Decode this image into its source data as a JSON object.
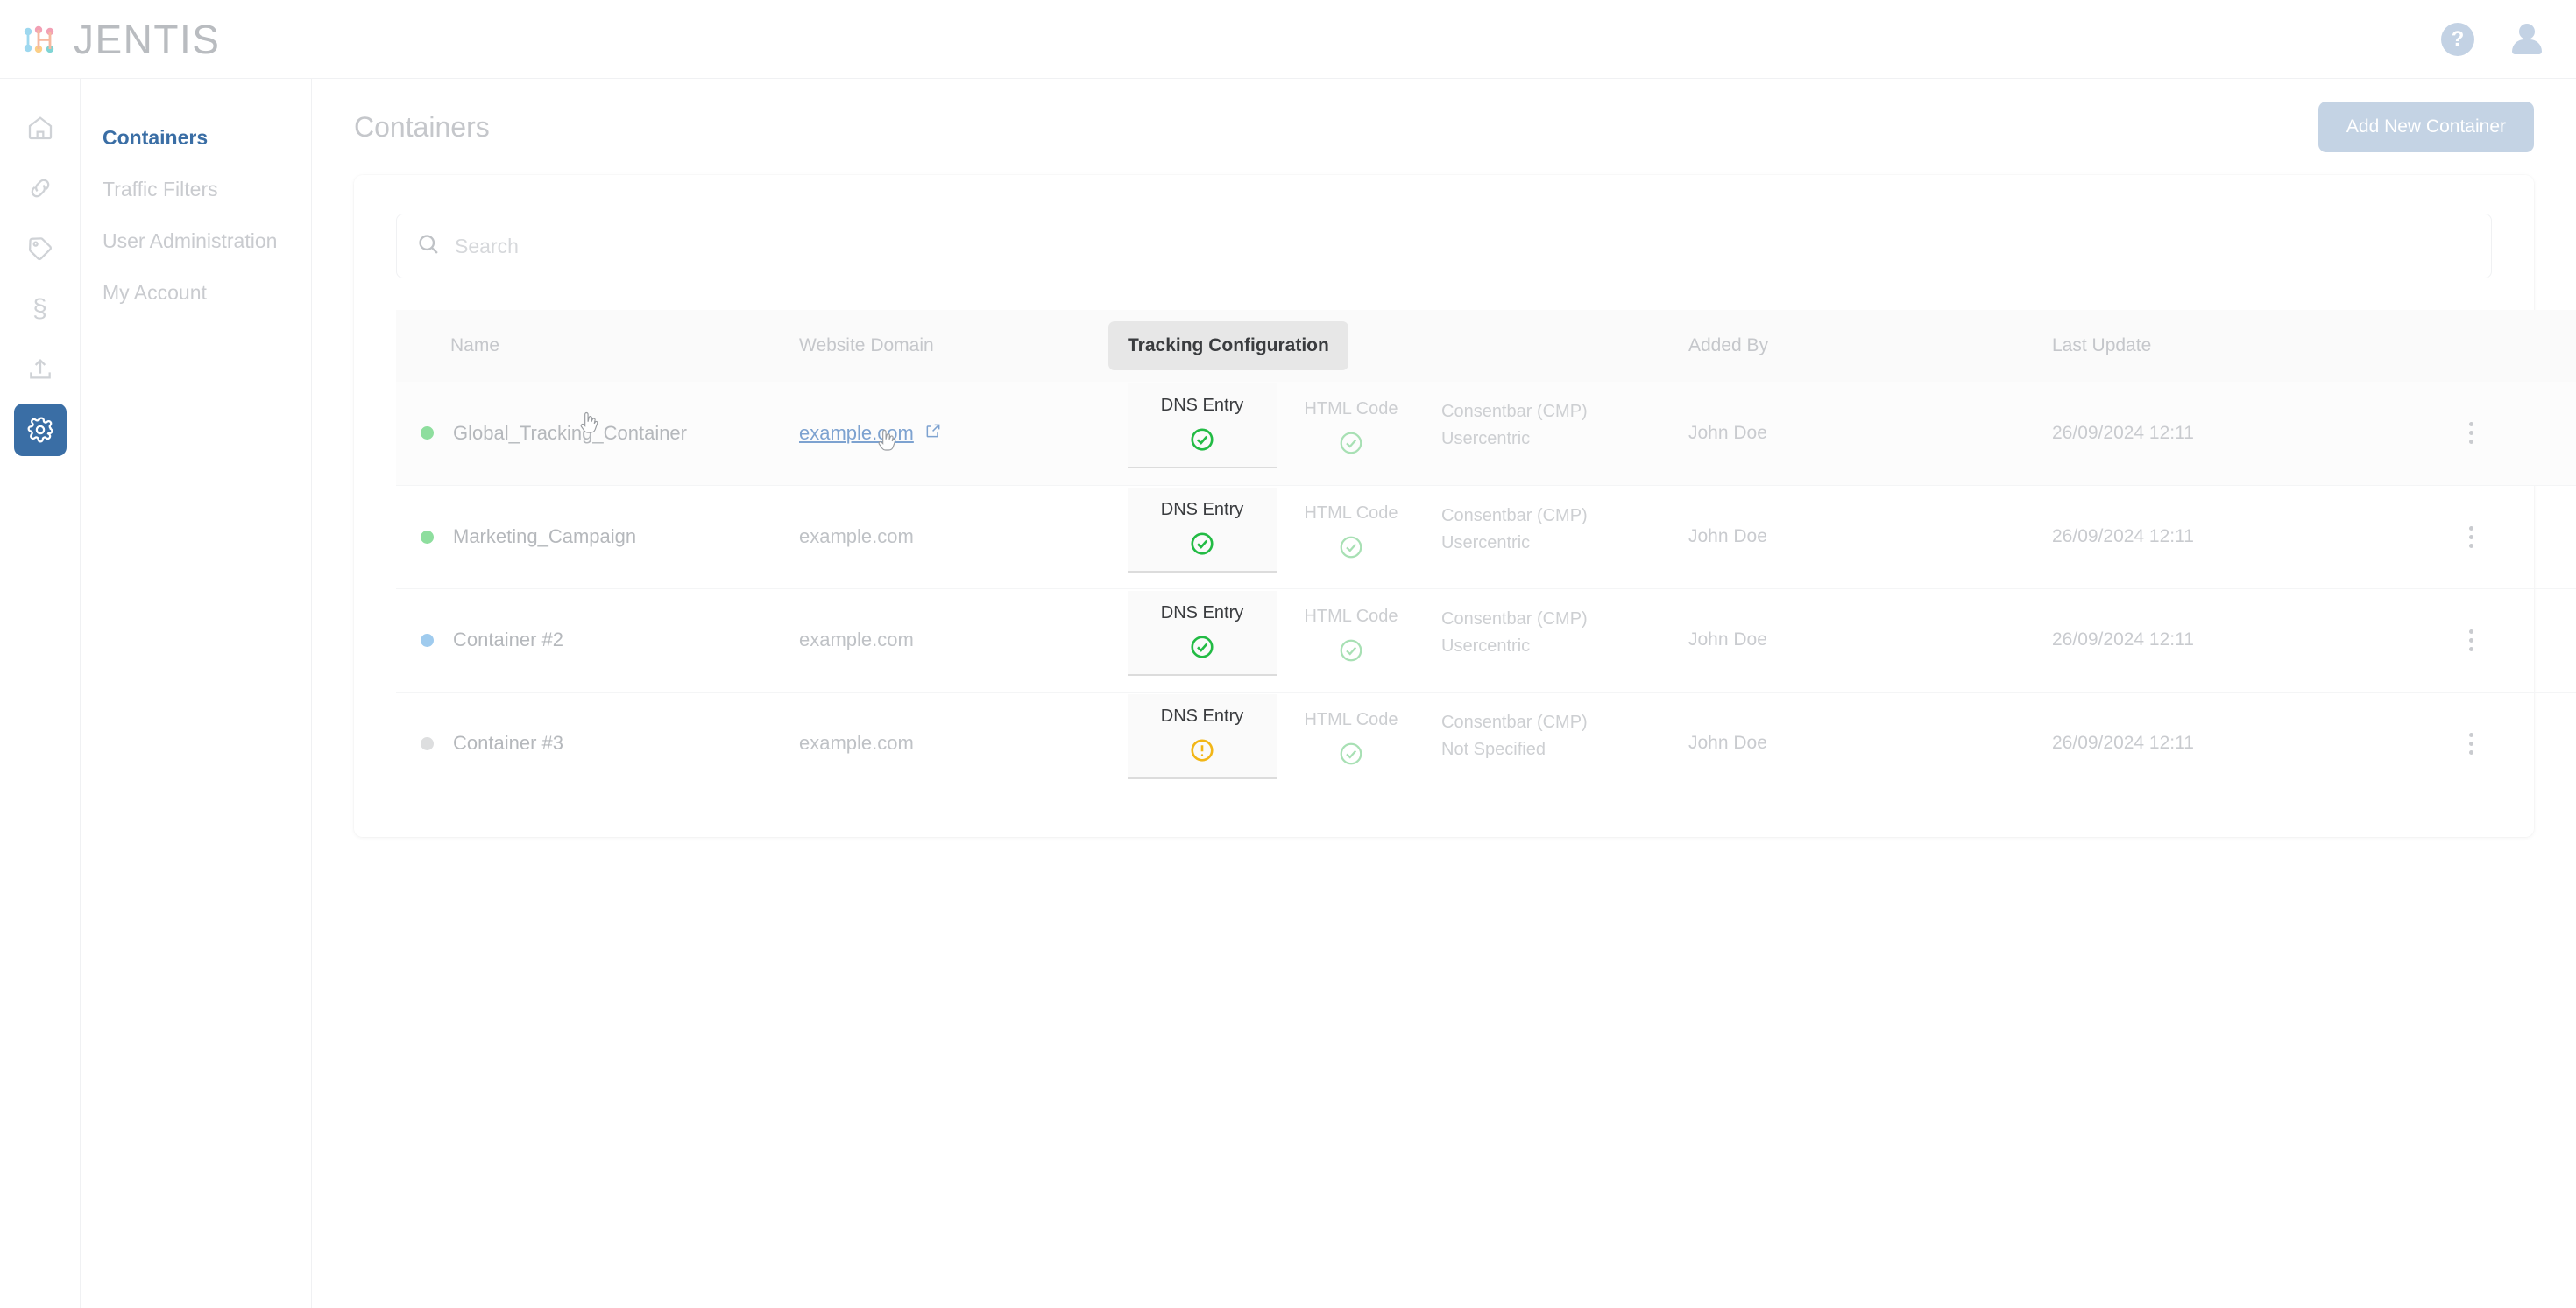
{
  "brand": {
    "name": "JENTIS"
  },
  "topbar": {
    "help_icon": "help-circle-icon",
    "help_glyph": "?",
    "account_icon": "user-avatar-icon"
  },
  "rail": {
    "items": [
      {
        "name": "home-icon",
        "label": "Home",
        "active": false
      },
      {
        "name": "link-icon",
        "label": "Connections",
        "active": false
      },
      {
        "name": "tag-icon",
        "label": "Tags",
        "active": false
      },
      {
        "name": "paragraph-icon",
        "label": "Legal",
        "glyph": "§",
        "active": false
      },
      {
        "name": "upload-icon",
        "label": "Publish",
        "active": false
      },
      {
        "name": "gear-icon",
        "label": "Settings",
        "active": true
      }
    ]
  },
  "sidebar": {
    "items": [
      {
        "label": "Containers",
        "active": true
      },
      {
        "label": "Traffic Filters",
        "active": false
      },
      {
        "label": "User Administration",
        "active": false
      },
      {
        "label": "My Account",
        "active": false
      }
    ]
  },
  "header": {
    "title": "Containers",
    "add_button_label": "Add New Container"
  },
  "search": {
    "placeholder": "Search",
    "value": "",
    "icon": "search-icon"
  },
  "table": {
    "columns": [
      {
        "key": "name",
        "label": "Name",
        "highlighted": false
      },
      {
        "key": "domain",
        "label": "Website Domain",
        "highlighted": false
      },
      {
        "key": "tracking",
        "label": "Tracking Configuration",
        "highlighted": true
      },
      {
        "key": "added",
        "label": "Added By",
        "highlighted": false
      },
      {
        "key": "updated",
        "label": "Last Update",
        "highlighted": false
      }
    ],
    "rows": [
      {
        "status_color": "#8ede9e",
        "name": "Global_Tracking_Container",
        "domain": "example.com",
        "domain_is_link": true,
        "tracking": {
          "dns": {
            "label": "DNS Entry",
            "state": "ok"
          },
          "html": {
            "label": "HTML Code",
            "state": "ok"
          },
          "cmp": {
            "line1": "Consentbar (CMP)",
            "line2": "Usercentric"
          }
        },
        "added_by": "John Doe",
        "last_update": "26/09/2024 12:11",
        "menu_icon": "kebab-menu-icon",
        "hovered": true
      },
      {
        "status_color": "#8ede9e",
        "name": "Marketing_Campaign",
        "domain": "example.com",
        "domain_is_link": false,
        "tracking": {
          "dns": {
            "label": "DNS Entry",
            "state": "ok"
          },
          "html": {
            "label": "HTML Code",
            "state": "ok"
          },
          "cmp": {
            "line1": "Consentbar (CMP)",
            "line2": "Usercentric"
          }
        },
        "added_by": "John Doe",
        "last_update": "26/09/2024 12:11",
        "menu_icon": "kebab-menu-icon",
        "hovered": false
      },
      {
        "status_color": "#9fcbee",
        "name": "Container #2",
        "domain": "example.com",
        "domain_is_link": false,
        "tracking": {
          "dns": {
            "label": "DNS Entry",
            "state": "ok"
          },
          "html": {
            "label": "HTML Code",
            "state": "ok"
          },
          "cmp": {
            "line1": "Consentbar (CMP)",
            "line2": "Usercentric"
          }
        },
        "added_by": "John Doe",
        "last_update": "26/09/2024 12:11",
        "menu_icon": "kebab-menu-icon",
        "hovered": false
      },
      {
        "status_color": "#dddedf",
        "name": "Container #3",
        "domain": "example.com",
        "domain_is_link": false,
        "tracking": {
          "dns": {
            "label": "DNS Entry",
            "state": "warning"
          },
          "html": {
            "label": "HTML Code",
            "state": "ok"
          },
          "cmp": {
            "line1": "Consentbar (CMP)",
            "line2": "Not Specified"
          }
        },
        "added_by": "John Doe",
        "last_update": "26/09/2024 12:11",
        "menu_icon": "kebab-menu-icon",
        "hovered": false
      }
    ]
  },
  "colors": {
    "accent_blue": "#3a6ea5",
    "status_ok": "#22bb44",
    "status_ok_faded": "#a8e0b4",
    "status_warning": "#f2b617",
    "muted_text": "#c5c7cb",
    "button_disabled": "#c4d3e4"
  }
}
